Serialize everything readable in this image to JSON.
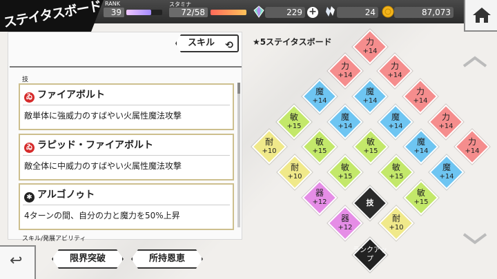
{
  "header": {
    "title": "ステイタスボード",
    "rank_label": "RANK",
    "rank_value": "39",
    "rank_progress": 0.7,
    "stamina_label": "スタミナ",
    "stamina_value": "72/58",
    "stamina_progress": 1.0,
    "gems": "229",
    "crystals": "24",
    "gold": "87,073",
    "plus": "+"
  },
  "panel": {
    "skill_button": "スキル",
    "section_waza": "技",
    "section_bottom": "スキル/発展アビリティ",
    "skills": [
      {
        "name": "ファイアボルト",
        "desc": "敵単体に強威力のすばやい火属性魔法攻撃",
        "icon": "fire-icon"
      },
      {
        "name": "ラピッド・ファイアボルト",
        "desc": "敵全体に中威力のすばやい火属性魔法攻撃",
        "icon": "fire-icon"
      },
      {
        "name": "アルゴノゥト",
        "desc": "4ターンの間、自分の力と魔力を50%上昇",
        "icon": "star-burst-icon"
      }
    ]
  },
  "buttons": {
    "limit_break": "限界突破",
    "owned_blessings": "所持恩恵"
  },
  "board": {
    "title": "★5ステイタスボード",
    "center": "技",
    "rank_up": "ランクアップ",
    "colors": {
      "power": "#f58d8d",
      "magic": "#6ec5f2",
      "agility": "#c3e86a",
      "endurance": "#f0e98a",
      "dexterity": "#e58de6",
      "center": "#2b2b2b"
    },
    "tiles": [
      {
        "kind": "力",
        "value": "+14",
        "type": "power"
      },
      {
        "kind": "力",
        "value": "+14",
        "type": "power"
      },
      {
        "kind": "力",
        "value": "+14",
        "type": "power"
      },
      {
        "kind": "魔",
        "value": "+14",
        "type": "magic"
      },
      {
        "kind": "魔",
        "value": "+14",
        "type": "magic"
      },
      {
        "kind": "力",
        "value": "+14",
        "type": "power"
      },
      {
        "kind": "敏",
        "value": "+15",
        "type": "agility"
      },
      {
        "kind": "魔",
        "value": "+14",
        "type": "magic"
      },
      {
        "kind": "魔",
        "value": "+14",
        "type": "magic"
      },
      {
        "kind": "力",
        "value": "+14",
        "type": "power"
      },
      {
        "kind": "耐",
        "value": "+10",
        "type": "endurance"
      },
      {
        "kind": "敏",
        "value": "+15",
        "type": "agility"
      },
      {
        "kind": "敏",
        "value": "+15",
        "type": "agility"
      },
      {
        "kind": "魔",
        "value": "+14",
        "type": "magic"
      },
      {
        "kind": "力",
        "value": "+14",
        "type": "power"
      },
      {
        "kind": "耐",
        "value": "+10",
        "type": "endurance"
      },
      {
        "kind": "敏",
        "value": "+15",
        "type": "agility"
      },
      {
        "kind": "敏",
        "value": "+15",
        "type": "agility"
      },
      {
        "kind": "魔",
        "value": "+14",
        "type": "magic"
      },
      {
        "kind": "器",
        "value": "+12",
        "type": "dexterity"
      },
      {
        "kind": "敏",
        "value": "+15",
        "type": "agility"
      },
      {
        "kind": "器",
        "value": "+12",
        "type": "dexterity"
      },
      {
        "kind": "耐",
        "value": "+10",
        "type": "endurance"
      }
    ]
  }
}
